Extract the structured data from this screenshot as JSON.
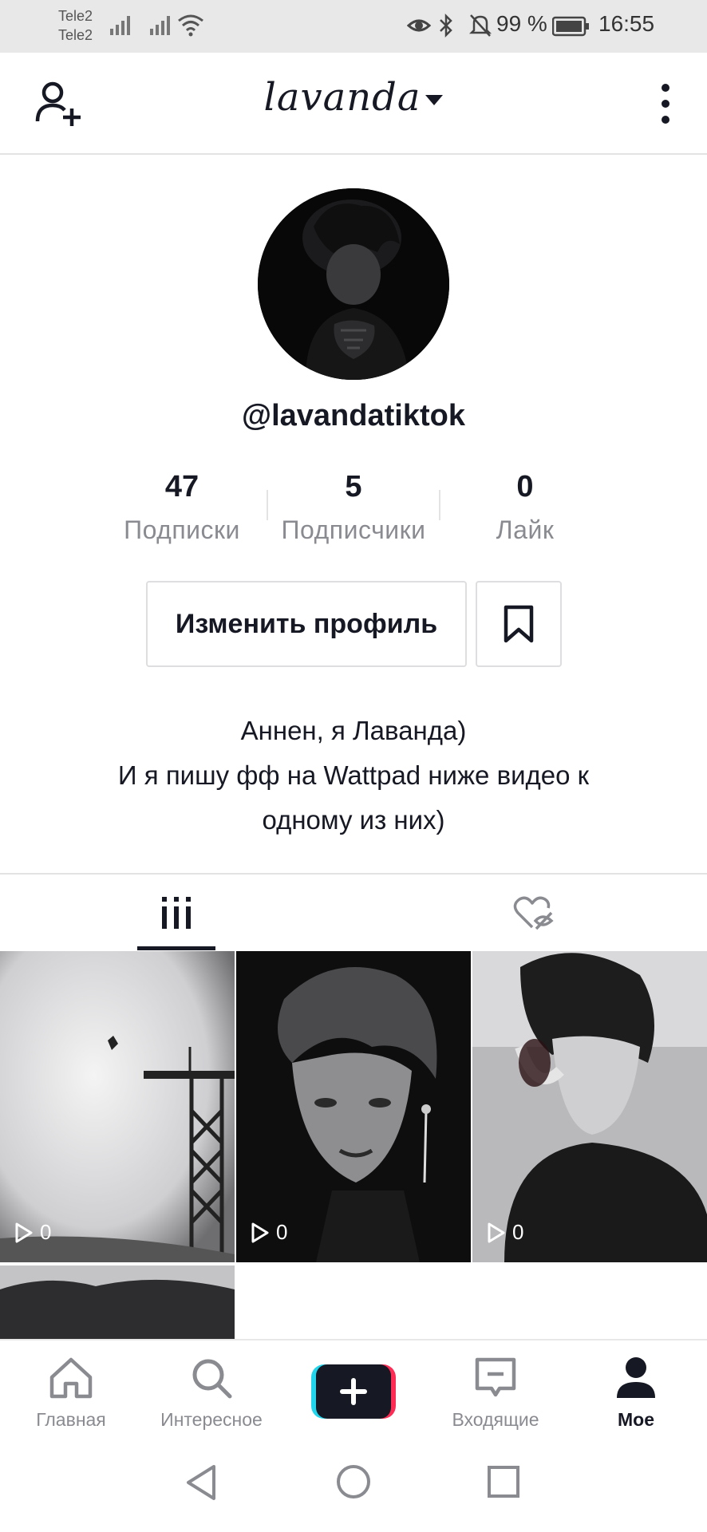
{
  "status_bar": {
    "carrier_1": "Tele2",
    "carrier_2": "Tele2",
    "battery_text": "99 %",
    "time": "16:55"
  },
  "header": {
    "title": "lavanda",
    "add_user_icon": "add-user-icon",
    "more_icon": "more-vertical-icon"
  },
  "profile": {
    "username": "@lavandatiktok",
    "stats": [
      {
        "value": "47",
        "label": "Подписки"
      },
      {
        "value": "5",
        "label": "Подписчики"
      },
      {
        "value": "0",
        "label": "Лайк"
      }
    ],
    "edit_button": "Изменить профиль",
    "bio_line_1": "Аннен, я Лаванда)",
    "bio_line_2": "И я пишу фф на Wattpad ниже видео к",
    "bio_line_3": "одному из них)"
  },
  "tabs": {
    "videos_icon": "grid-bars-icon",
    "liked_icon": "hidden-heart-icon",
    "active": "videos"
  },
  "videos": [
    {
      "views": "0"
    },
    {
      "views": "0"
    },
    {
      "views": "0"
    }
  ],
  "bottom_nav": [
    {
      "label": "Главная",
      "icon": "home-icon"
    },
    {
      "label": "Интересное",
      "icon": "search-icon"
    },
    {
      "label": "",
      "icon": "plus-icon"
    },
    {
      "label": "Входящие",
      "icon": "inbox-icon"
    },
    {
      "label": "Мое",
      "icon": "profile-icon",
      "active": true
    }
  ],
  "colors": {
    "text": "#161823",
    "muted": "#8a8b91",
    "border": "#e3e3e4",
    "create_cyan": "#20d5ec",
    "create_red": "#fe2c55"
  }
}
